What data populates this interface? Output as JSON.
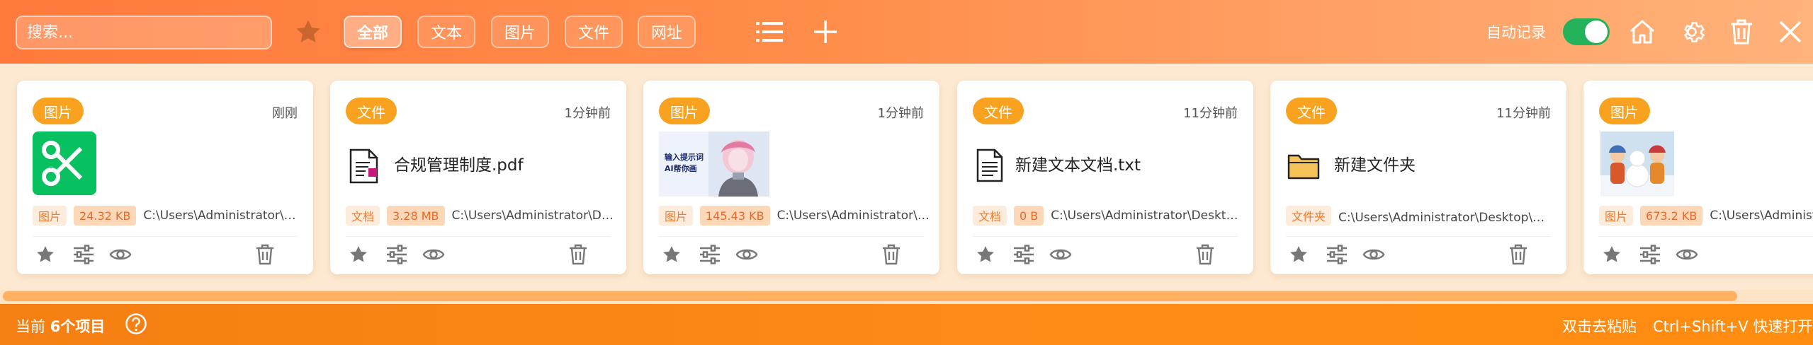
{
  "search": {
    "placeholder": "搜索..."
  },
  "filters": {
    "favorite_icon": "star-icon",
    "tabs": [
      {
        "label": "全部",
        "active": true
      },
      {
        "label": "文本",
        "active": false
      },
      {
        "label": "图片",
        "active": false
      },
      {
        "label": "文件",
        "active": false
      },
      {
        "label": "网址",
        "active": false
      }
    ]
  },
  "toolbar": {
    "list_icon": "list-icon",
    "add_icon": "plus-icon",
    "auto_record_label": "自动记录",
    "auto_record_on": true,
    "home_icon": "home-icon",
    "settings_icon": "gear-icon",
    "delete_icon": "trash-icon",
    "close_icon": "close-icon"
  },
  "cards": [
    {
      "type": "图片",
      "time": "刚刚",
      "kind": "scissors-app-icon",
      "name": "",
      "chip": "图片",
      "size": "24.32 KB",
      "path": "C:\\Users\\Administrator\\Des..."
    },
    {
      "type": "文件",
      "time": "1分钟前",
      "kind": "pdf-file-icon",
      "name": "合规管理制度.pdf",
      "chip": "文档",
      "size": "3.28 MB",
      "path": "C:\\Users\\Administrator\\Des..."
    },
    {
      "type": "图片",
      "time": "1分钟前",
      "kind": "robot-image-thumbnail",
      "thumb_text": "输入提示词\nAI帮你画",
      "name": "",
      "chip": "图片",
      "size": "145.43 KB",
      "path": "C:\\Users\\Administrator\\De..."
    },
    {
      "type": "文件",
      "time": "11分钟前",
      "kind": "text-file-icon",
      "name": "新建文本文档.txt",
      "chip": "文档",
      "size": "0 B",
      "path": "C:\\Users\\Administrator\\Desktop\\..."
    },
    {
      "type": "文件",
      "time": "11分钟前",
      "kind": "folder-icon",
      "name": "新建文件夹",
      "chip": "文件夹",
      "size": "",
      "path": "C:\\Users\\Administrator\\Desktop\\新建..."
    },
    {
      "type": "图片",
      "time": "",
      "kind": "snowman-image-thumbnail",
      "name": "",
      "chip": "图片",
      "size": "673.2 KB",
      "path": "C:\\Users\\Administra"
    }
  ],
  "card_actions": [
    "star-icon",
    "sliders-icon",
    "eye-icon",
    "trash-icon"
  ],
  "status": {
    "count_prefix": "当前",
    "count_value": "6个项目",
    "help_icon": "question-circle-icon",
    "hint_dblclick": "双击去粘贴",
    "hint_shortcut": "Ctrl+Shift+V 快速打开"
  },
  "colors": {
    "accent": "#ff7a3c",
    "badge": "#f8a21f",
    "toggle_on": "#23b25a",
    "status_bar": "#ff8a17"
  }
}
